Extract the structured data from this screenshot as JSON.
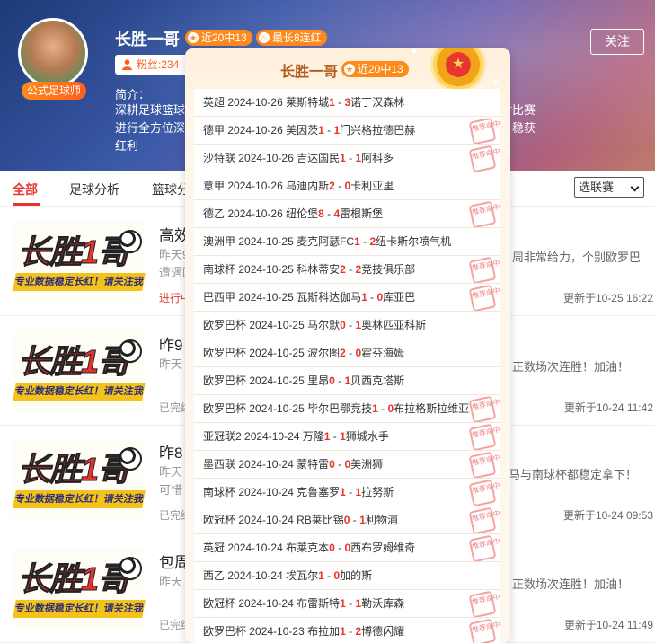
{
  "profile": {
    "name": "长胜一哥",
    "tag": "公式足球师",
    "badge_recent": "近20中13",
    "badge_streak": "最长8连红",
    "fans": "粉丝:234",
    "follow_label": "关注",
    "intro_label": "简介：",
    "intro_text": "深耕足球篮球赛事分析多年，专业数据稳定长红，以客观冷静的数据说话，对比赛进行全方位深度分析，各大联赛及杯赛都有涉猎，专注大小球进球数据前端，稳获红利"
  },
  "tabs": [
    "全部",
    "足球分析",
    "篮球分析"
  ],
  "league_select": "选联赛",
  "thumb": {
    "main": "长胜1哥",
    "sub": "专业数据稳定长红！请关注我"
  },
  "articles": [
    {
      "title": "高效",
      "desc_left": "昨天9",
      "desc_left2": "遭遇回",
      "desc_right": "周非常给力，个别欧罗巴",
      "status": "进行中",
      "time": "更新于10-25 16:22"
    },
    {
      "title": "昨9",
      "desc_left": "昨天",
      "desc_left2": "",
      "desc_right": "正数场次连胜！加油！",
      "status": "已完结",
      "time": "更新于10-24 11:42"
    },
    {
      "title": "昨8",
      "desc_left": "昨天",
      "desc_left2": "可惜",
      "desc_right": "马与南球杯都稳定拿下！",
      "status": "已完结",
      "time": "更新于10-24 09:53"
    },
    {
      "title": "包周",
      "desc_left": "昨天",
      "desc_left2": "",
      "desc_right": "正数场次连胜！加油！",
      "status": "已完结",
      "time": "更新于10-24 11:49"
    }
  ],
  "popup": {
    "name": "长胜一哥",
    "badge": "近20中13",
    "stamp_text": "推荐命中",
    "matches": [
      {
        "league": "英超",
        "date": "2024-10-26",
        "home": "莱斯特城",
        "hs": "1",
        "as": "3",
        "away": "诺丁汉森林",
        "hit": false
      },
      {
        "league": "德甲",
        "date": "2024-10-26",
        "home": "美因茨",
        "hs": "1",
        "as": "1",
        "away": "门兴格拉德巴赫",
        "hit": true
      },
      {
        "league": "沙特联",
        "date": "2024-10-26",
        "home": "吉达国民",
        "hs": "1",
        "as": "1",
        "away": "阿科多",
        "hit": true
      },
      {
        "league": "意甲",
        "date": "2024-10-26",
        "home": "乌迪内斯",
        "hs": "2",
        "as": "0",
        "away": "卡利亚里",
        "hit": false
      },
      {
        "league": "德乙",
        "date": "2024-10-26",
        "home": "纽伦堡",
        "hs": "8",
        "as": "4",
        "away": "雷根斯堡",
        "hit": true
      },
      {
        "league": "澳洲甲",
        "date": "2024-10-25",
        "home": "麦克阿瑟FC",
        "hs": "1",
        "as": "2",
        "away": "纽卡斯尔喷气机",
        "hit": false
      },
      {
        "league": "南球杯",
        "date": "2024-10-25",
        "home": "科林蒂安",
        "hs": "2",
        "as": "2",
        "away": "竞技俱乐部",
        "hit": true
      },
      {
        "league": "巴西甲",
        "date": "2024-10-25",
        "home": "瓦斯科达伽马",
        "hs": "1",
        "as": "0",
        "away": "库亚巴",
        "hit": true
      },
      {
        "league": "欧罗巴杯",
        "date": "2024-10-25",
        "home": "马尔默",
        "hs": "0",
        "as": "1",
        "away": "奥林匹亚科斯",
        "hit": false
      },
      {
        "league": "欧罗巴杯",
        "date": "2024-10-25",
        "home": "波尔图",
        "hs": "2",
        "as": "0",
        "away": "霍芬海姆",
        "hit": false
      },
      {
        "league": "欧罗巴杯",
        "date": "2024-10-25",
        "home": "里昂",
        "hs": "0",
        "as": "1",
        "away": "贝西克塔斯",
        "hit": false
      },
      {
        "league": "欧罗巴杯",
        "date": "2024-10-25",
        "home": "毕尔巴鄂竞技",
        "hs": "1",
        "as": "0",
        "away": "布拉格斯拉维亚",
        "hit": true
      },
      {
        "league": "亚冠联2",
        "date": "2024-10-24",
        "home": "万隆",
        "hs": "1",
        "as": "1",
        "away": "狮城水手",
        "hit": true
      },
      {
        "league": "墨西联",
        "date": "2024-10-24",
        "home": "蒙特雷",
        "hs": "0",
        "as": "0",
        "away": "美洲狮",
        "hit": true
      },
      {
        "league": "南球杯",
        "date": "2024-10-24",
        "home": "克鲁塞罗",
        "hs": "1",
        "as": "1",
        "away": "拉努斯",
        "hit": true
      },
      {
        "league": "欧冠杯",
        "date": "2024-10-24",
        "home": "RB莱比锡",
        "hs": "0",
        "as": "1",
        "away": "利物浦",
        "hit": true
      },
      {
        "league": "英冠",
        "date": "2024-10-24",
        "home": "布莱克本",
        "hs": "0",
        "as": "0",
        "away": "西布罗姆维奇",
        "hit": true
      },
      {
        "league": "西乙",
        "date": "2024-10-24",
        "home": "埃瓦尔",
        "hs": "1",
        "as": "0",
        "away": "加的斯",
        "hit": false
      },
      {
        "league": "欧冠杯",
        "date": "2024-10-24",
        "home": "布雷斯特",
        "hs": "1",
        "as": "1",
        "away": "勒沃库森",
        "hit": true
      },
      {
        "league": "欧罗巴杯",
        "date": "2024-10-23",
        "home": "布拉加",
        "hs": "1",
        "as": "2",
        "away": "博德闪耀",
        "hit": true
      }
    ]
  }
}
